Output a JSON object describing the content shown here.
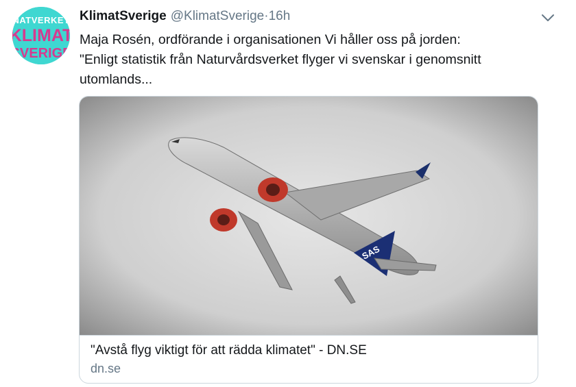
{
  "tweet": {
    "author_name": "KlimatSverige",
    "handle": "@KlimatSverige",
    "separator": "·",
    "time": "16h",
    "lines": [
      "Maja Rosén, ordförande i organisationen Vi håller oss på jorden:",
      "\"Enligt statistik från Naturvårdsverket flyger vi svenskar i genomsnitt",
      "utomlands..."
    ]
  },
  "avatar": {
    "logo_lines": [
      "NATVERKET",
      "KLIMAT",
      "SVERIGE"
    ],
    "bg_color": "#3fd7d1",
    "text_color": "#d63a8f"
  },
  "card": {
    "title": "\"Avstå flyg viktigt för att rädda klimatet\" - DN.SE",
    "domain": "dn.se",
    "image_subject": "airplane-in-sky"
  },
  "icons": {
    "more": "chevron-down-icon"
  }
}
